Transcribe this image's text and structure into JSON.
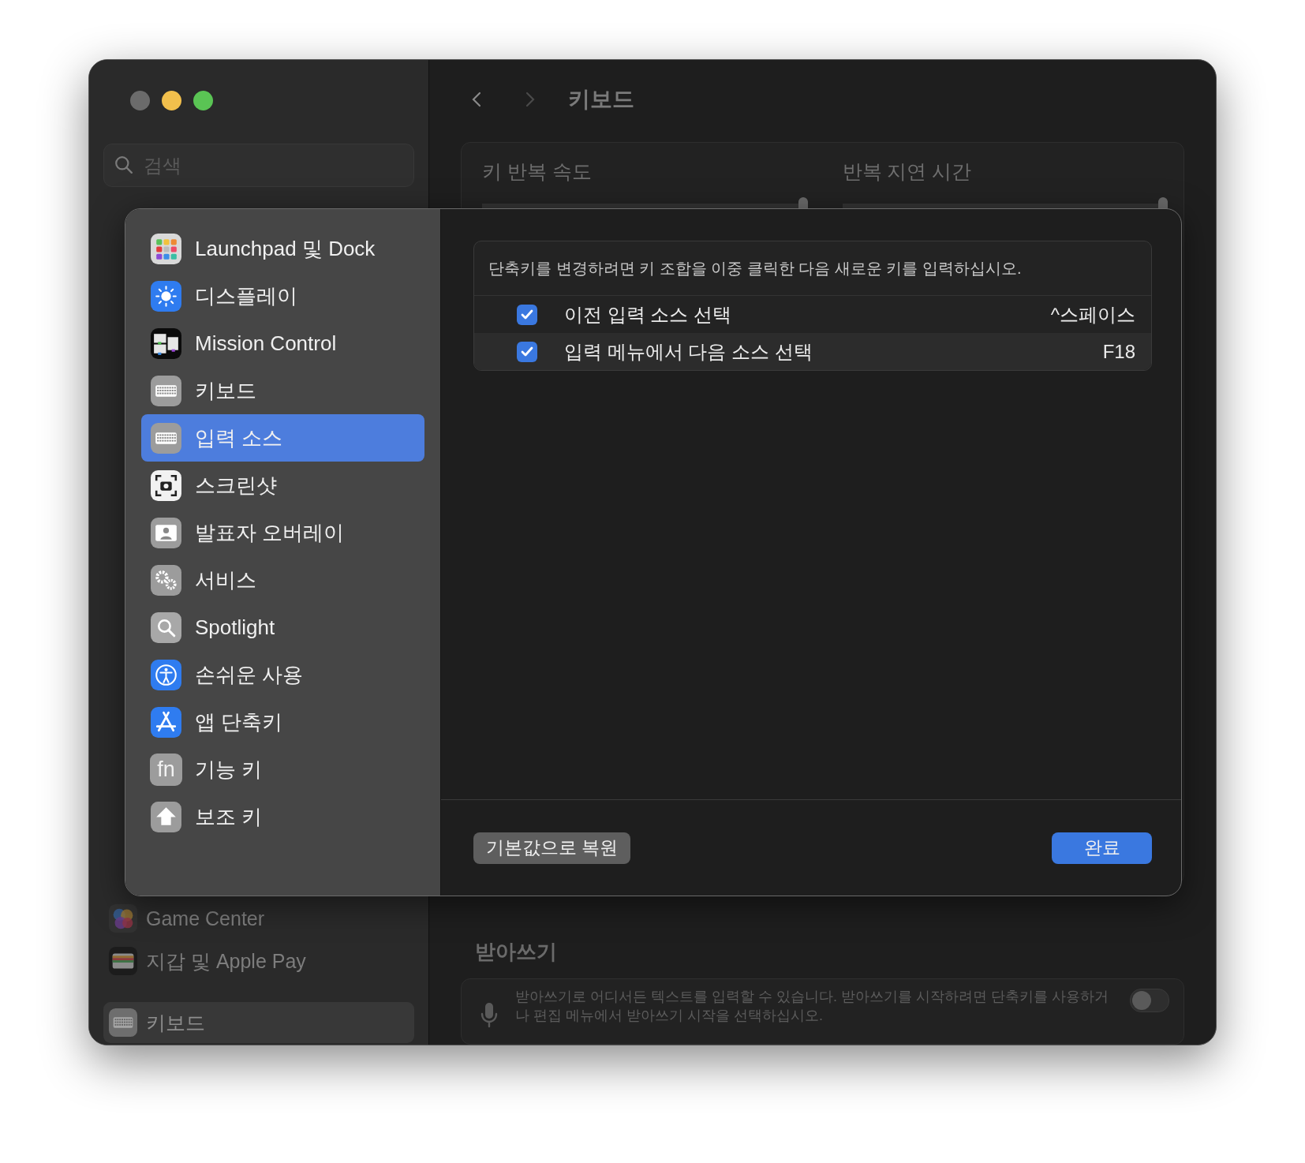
{
  "sidebar": {
    "search": {
      "placeholder": "검색"
    },
    "items": [
      {
        "label": "Game Center",
        "selected": false
      },
      {
        "label": "지갑 및 Apple Pay",
        "selected": false
      },
      {
        "label": "키보드",
        "selected": true
      }
    ]
  },
  "header": {
    "title": "키보드"
  },
  "repeat_card": {
    "sliders": [
      {
        "label": "키 반복 속도",
        "level": 1
      },
      {
        "label": "반복 지연 시간",
        "level": 1
      }
    ]
  },
  "dictation": {
    "heading": "받아쓰기",
    "description": "받아쓰기로 어디서든 텍스트를 입력할 수 있습니다. 받아쓰기를 시작하려면 단축키를 사용하거나 편집 메뉴에서 받아쓰기 시작을 선택하십시오.",
    "on": false
  },
  "sheet": {
    "categories": [
      {
        "label": "Launchpad 및 Dock",
        "selected": false
      },
      {
        "label": "디스플레이",
        "selected": false
      },
      {
        "label": "Mission Control",
        "selected": false
      },
      {
        "label": "키보드",
        "selected": false
      },
      {
        "label": "입력 소스",
        "selected": true
      },
      {
        "label": "스크린샷",
        "selected": false
      },
      {
        "label": "발표자 오버레이",
        "selected": false
      },
      {
        "label": "서비스",
        "selected": false
      },
      {
        "label": "Spotlight",
        "selected": false
      },
      {
        "label": "손쉬운 사용",
        "selected": false
      },
      {
        "label": "앱 단축키",
        "selected": false
      },
      {
        "label": "기능 키",
        "glyph": "fn",
        "selected": false
      },
      {
        "label": "보조 키",
        "selected": false
      }
    ],
    "hint": "단축키를 변경하려면 키 조합을 이중 클릭한 다음 새로운 키를 입력하십시오.",
    "shortcuts": [
      {
        "checked": true,
        "label": "이전 입력 소스 선택",
        "keys": "^스페이스"
      },
      {
        "checked": true,
        "label": "입력 메뉴에서 다음 소스 선택",
        "keys": "F18"
      }
    ],
    "buttons": [
      {
        "label": "기본값으로 복원",
        "kind": "secondary"
      },
      {
        "label": "완료",
        "kind": "primary"
      }
    ]
  }
}
